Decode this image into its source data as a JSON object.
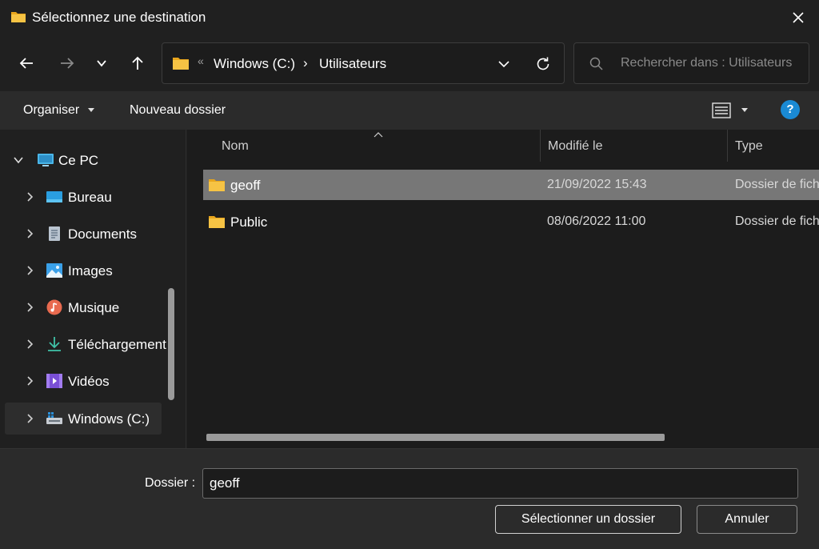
{
  "window": {
    "title": "Sélectionnez une destination"
  },
  "icons": {
    "title": "folder-icon",
    "close": "close-icon",
    "back": "arrow-left-icon",
    "forward": "arrow-right-icon",
    "recent": "chevron-down-icon",
    "up": "arrow-up-icon",
    "refresh": "refresh-icon",
    "search": "search-icon",
    "view": "details-view-icon",
    "help": "help-icon"
  },
  "address": {
    "overflow": "«",
    "crumbs": [
      "Windows (C:)",
      "Utilisateurs"
    ],
    "separator": "›"
  },
  "search": {
    "placeholder": "Rechercher dans : Utilisateurs"
  },
  "command": {
    "organize": "Organiser",
    "new_folder": "Nouveau dossier",
    "help": "?"
  },
  "tree": {
    "items": [
      {
        "label": "Ce PC",
        "icon": "computer-icon"
      },
      {
        "label": "Bureau",
        "icon": "desktop-icon"
      },
      {
        "label": "Documents",
        "icon": "documents-icon"
      },
      {
        "label": "Images",
        "icon": "images-icon"
      },
      {
        "label": "Musique",
        "icon": "music-icon"
      },
      {
        "label": "Téléchargement",
        "icon": "download-icon"
      },
      {
        "label": "Vidéos",
        "icon": "videos-icon"
      },
      {
        "label": "Windows (C:)",
        "icon": "drive-icon"
      }
    ]
  },
  "list": {
    "columns": [
      "Nom",
      "Modifié le",
      "Type"
    ],
    "rows": [
      {
        "name": "geoff",
        "modified": "21/09/2022 15:43",
        "type": "Dossier de fichiers"
      },
      {
        "name": "Public",
        "modified": "08/06/2022 11:00",
        "type": "Dossier de fichiers"
      }
    ]
  },
  "footer": {
    "folder_label": "Dossier :",
    "folder_value": "geoff",
    "select_button": "Sélectionner un dossier",
    "cancel_button": "Annuler"
  },
  "colors": {
    "background": "#202020",
    "selection": "#777777",
    "accent": "#1a8ad4",
    "folder": "#f6c344"
  }
}
